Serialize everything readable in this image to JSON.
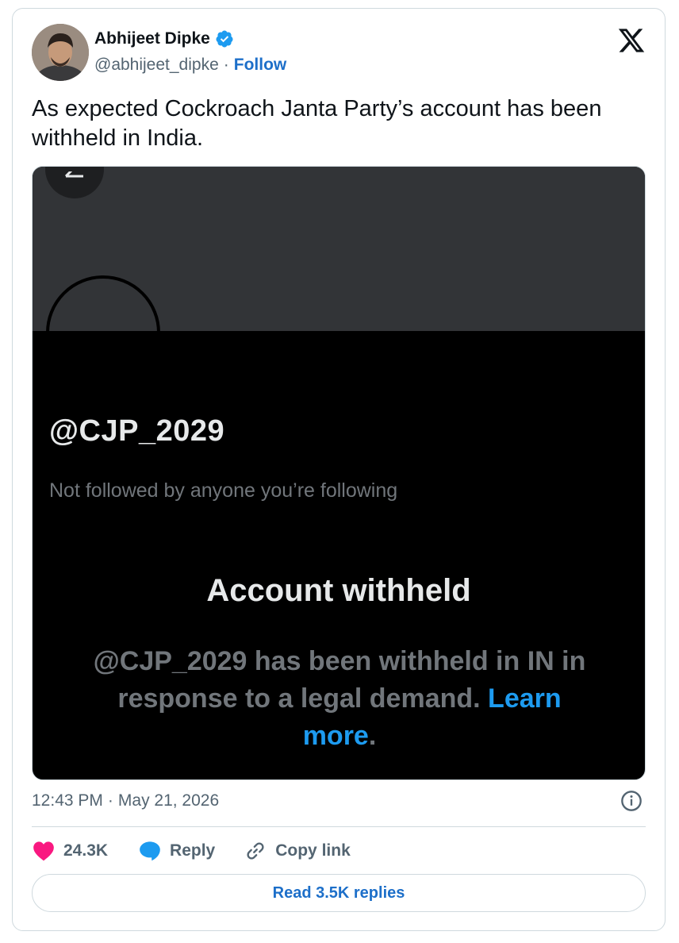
{
  "author": {
    "name": "Abhijeet Dipke",
    "handle": "@abhijeet_dipke",
    "separator": "·",
    "follow_label": "Follow"
  },
  "tweet": {
    "text": "As expected Cockroach Janta Party’s account has been withheld in India."
  },
  "media": {
    "handle": "@CJP_2029",
    "subtitle": "Not followed by anyone you’re following",
    "title": "Account withheld",
    "body": "@CJP_2029 has been withheld in IN in response to a legal demand.",
    "link_text": "Learn more",
    "link_end": "."
  },
  "meta": {
    "time": "12:43 PM",
    "separator": "·",
    "date": "May 21, 2026"
  },
  "actions": {
    "likes": "24.3K",
    "reply_label": "Reply",
    "copy_label": "Copy link"
  },
  "read_replies_label": "Read 3.5K replies",
  "colors": {
    "accent": "#1d9bf0",
    "link_blue": "#1d6fc9",
    "heart": "#f91880",
    "muted": "#536471"
  }
}
